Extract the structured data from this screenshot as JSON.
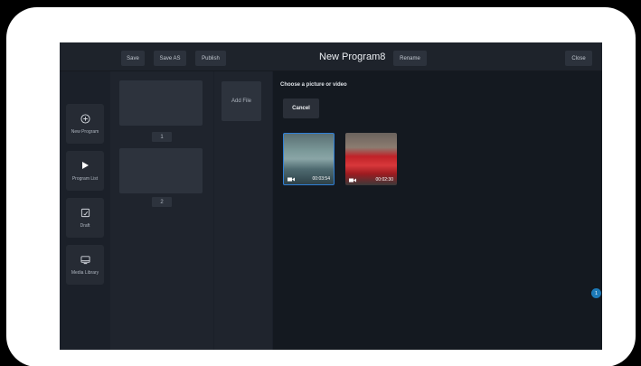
{
  "topbar": {
    "buttons": [
      {
        "label": "Save"
      },
      {
        "label": "Save AS"
      },
      {
        "label": "Publish"
      }
    ],
    "title": "New Program8",
    "rename_label": "Rename",
    "close_label": "Close"
  },
  "sidebar": {
    "items": [
      {
        "label": "New Program",
        "icon": "plus-circle-icon"
      },
      {
        "label": "Program List",
        "icon": "play-icon"
      },
      {
        "label": "Draft",
        "icon": "draft-edit-icon"
      },
      {
        "label": "Media Library",
        "icon": "media-library-icon"
      }
    ]
  },
  "program_list": {
    "items": [
      {
        "index": "1"
      },
      {
        "index": "2"
      }
    ]
  },
  "file_column": {
    "add_file_label": "Add File"
  },
  "picker": {
    "heading": "Choose a picture or video",
    "cancel_label": "Cancel",
    "media": [
      {
        "duration": "00:03:54",
        "selected": true,
        "type": "video"
      },
      {
        "duration": "00:02:30",
        "selected": false,
        "type": "video"
      }
    ]
  },
  "badge": {
    "count": "1"
  },
  "colors": {
    "accent": "#2f7fd6",
    "badge": "#1d7ab8",
    "background": "#1b2029",
    "panel": "#141920"
  }
}
